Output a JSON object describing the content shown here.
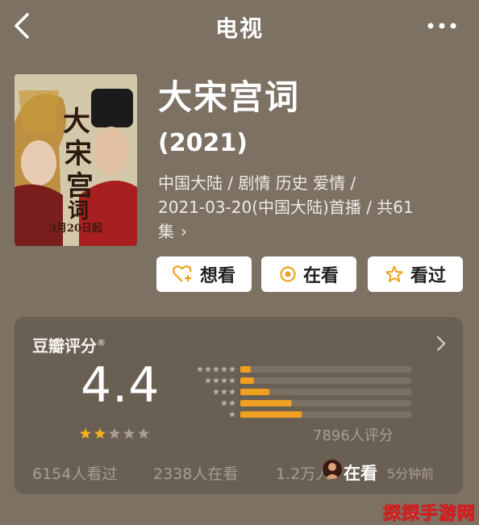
{
  "header": {
    "title": "电视"
  },
  "movie": {
    "title": "大宋宫词",
    "year": "(2021)",
    "meta_line1": "中国大陆 / 剧情 历史 爱情 /",
    "meta_line2": "2021-03-20(中国大陆)首播 / 共61",
    "meta_line3": "集",
    "poster_date": "3月20日起"
  },
  "actions": {
    "want": "想看",
    "doing": "在看",
    "done": "看过"
  },
  "rating": {
    "label": "豆瓣评分",
    "label_mark": "®",
    "score": "4.4",
    "stars_filled": 2,
    "stars_total": 5,
    "distribution": [
      0.06,
      0.08,
      0.17,
      0.3,
      0.36
    ],
    "votes": "7896人评分",
    "watched": "6154人看过",
    "watching": "2338人在看",
    "want_partial": "1.2万人",
    "now_watching": "在看",
    "time_ago": "5分钟前"
  },
  "colors": {
    "background": "#7d7164",
    "card": "#6a5f53",
    "accent_orange": "#f0a020",
    "star_gold": "#f3b11b",
    "muted_text": "#a89d90"
  },
  "watermark": "探探手游网"
}
